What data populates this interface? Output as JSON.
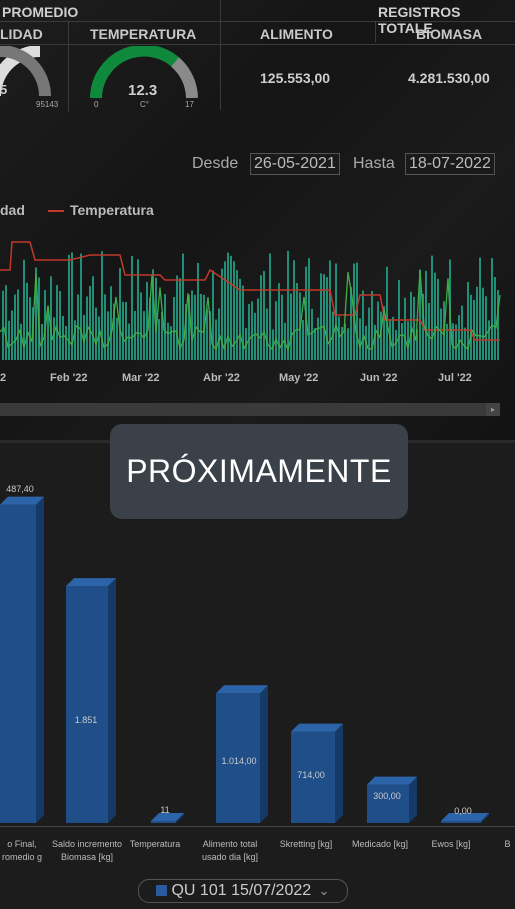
{
  "summary": {
    "group1_title": "PROMEDIO",
    "group2_title": "REGISTROS TOTALE",
    "col_humidity": "LIDAD",
    "col_temperature": "TEMPERATURA",
    "col_food": "ALIMENTO",
    "col_biomass": "BIOMASA",
    "humidity_value": "5",
    "humidity_max": "95143",
    "temperature_value": "12.3",
    "temperature_unit": "C°",
    "temperature_min": "0",
    "temperature_max": "17",
    "food_total": "125.553,00",
    "biomass_total": "4.281.530,00"
  },
  "date_range": {
    "from_label": "Desde",
    "from_value": "26-05-2021",
    "to_label": "Hasta",
    "to_value": "18-07-2022"
  },
  "timeline_chart": {
    "legend": [
      "dad",
      "Temperatura"
    ],
    "x_ticks": [
      "2",
      "Feb '22",
      "Mar '22",
      "Abr '22",
      "May '22",
      "Jun '22",
      "Jul '22"
    ],
    "colors": {
      "bars": "#1f8f77",
      "line_temp": "#c0392b",
      "line_green": "#3fae49"
    }
  },
  "overlay": {
    "text": "PRÓXIMAMENTE"
  },
  "chart_data": {
    "type": "bar",
    "categories": [
      "o Final, romedio g",
      "Saldo incremento Biomasa [kg]",
      "Temperatura",
      "Alimento total usado dia [kg]",
      "Skretting [kg]",
      "Medicado [kg]",
      "Ewos [kg]",
      "B"
    ],
    "values": [
      2487.4,
      1851,
      11,
      1014.0,
      714.0,
      300.0,
      0.0,
      null
    ],
    "data_labels": [
      "487,40",
      "1.851",
      "11",
      "1.014,00",
      "714,00",
      "300,00",
      "0,00",
      ""
    ],
    "color": "#1f4e89"
  },
  "footer": {
    "selector_label": "QU 101 15/07/2022"
  }
}
